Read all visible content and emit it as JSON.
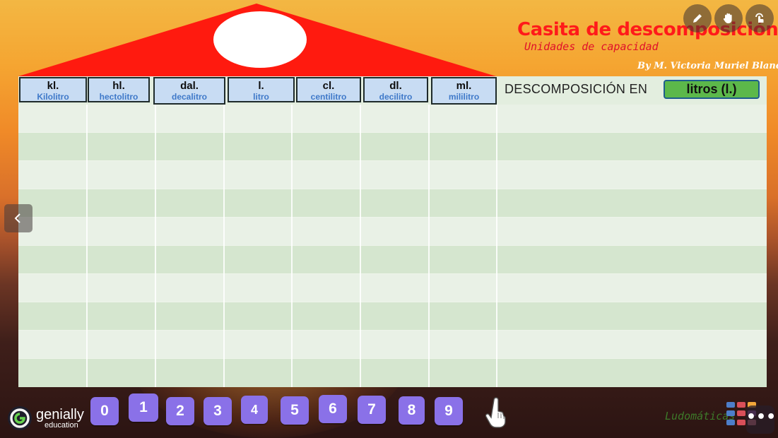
{
  "header": {
    "title": "Casita de descomposición",
    "subtitle": "Unidades de capacidad",
    "author": "By M. Victoria Muriel Blanco"
  },
  "table": {
    "columns": [
      {
        "abbr": "kl.",
        "full": "Kilolitro"
      },
      {
        "abbr": "hl.",
        "full": "hectolitro"
      },
      {
        "abbr": "dal.",
        "full": "decalitro"
      },
      {
        "abbr": "l.",
        "full": "litro"
      },
      {
        "abbr": "cl.",
        "full": "centilitro"
      },
      {
        "abbr": "dl.",
        "full": "decilitro"
      },
      {
        "abbr": "ml.",
        "full": "mililitro"
      }
    ],
    "decomposition_label": "DESCOMPOSICIÓN EN",
    "unit_badge": "litros (l.)"
  },
  "number_tiles": [
    "0",
    "1",
    "2",
    "3",
    "4",
    "5",
    "6",
    "7",
    "8",
    "9"
  ],
  "toolbar": {
    "icons": [
      "pencil-icon",
      "hand-icon",
      "touch-icon"
    ]
  },
  "branding": {
    "genially_name": "genially",
    "genially_sub": "education",
    "ludomaticas": "Ludomáticas"
  },
  "colors": {
    "roof": "#ff1a0f",
    "title": "#ff1a1a",
    "tile": "#8a71e8",
    "header_cell": "#c8dcf3",
    "unit_badge": "#5cb84a"
  }
}
